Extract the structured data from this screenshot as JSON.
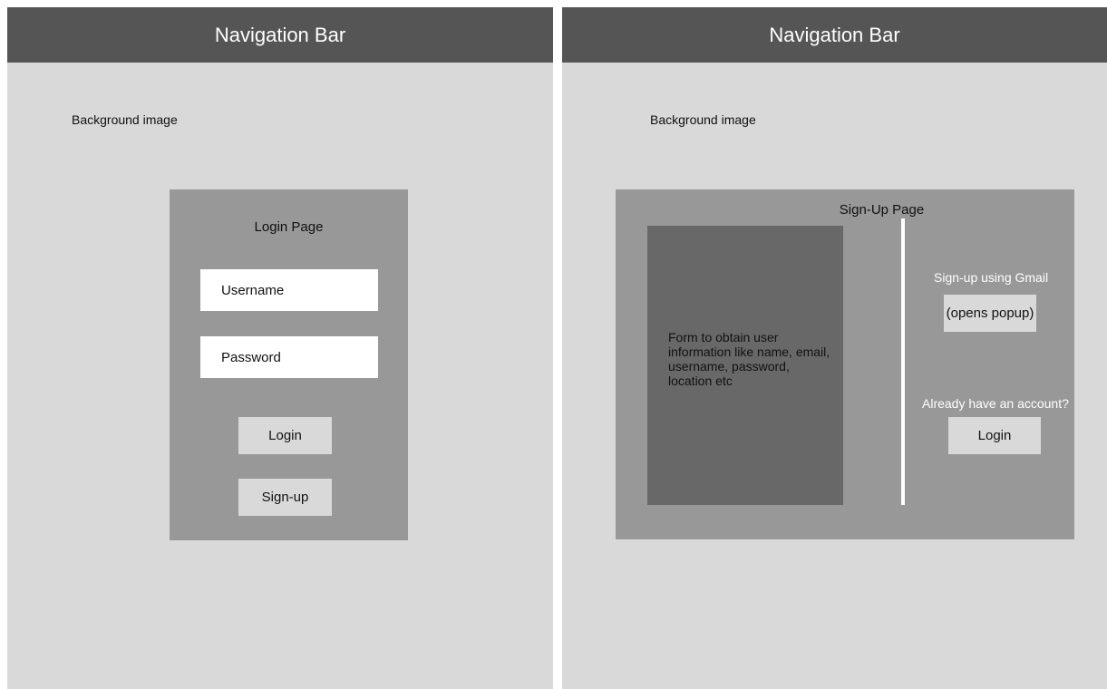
{
  "login_screen": {
    "nav_title": "Navigation Bar",
    "background_label": "Background image",
    "card_title": "Login Page",
    "username_placeholder": "Username",
    "password_placeholder": "Password",
    "login_label": "Login",
    "signup_label": "Sign-up"
  },
  "signup_screen": {
    "nav_title": "Navigation Bar",
    "background_label": "Background image",
    "card_title": "Sign-Up Page",
    "form_description": "Form to obtain user information like name, email,  username, password, location etc",
    "gmail_label": "Sign-up using Gmail",
    "gmail_button_label": "(opens popup)",
    "already_label": "Already have an account?",
    "login_label": "Login"
  }
}
